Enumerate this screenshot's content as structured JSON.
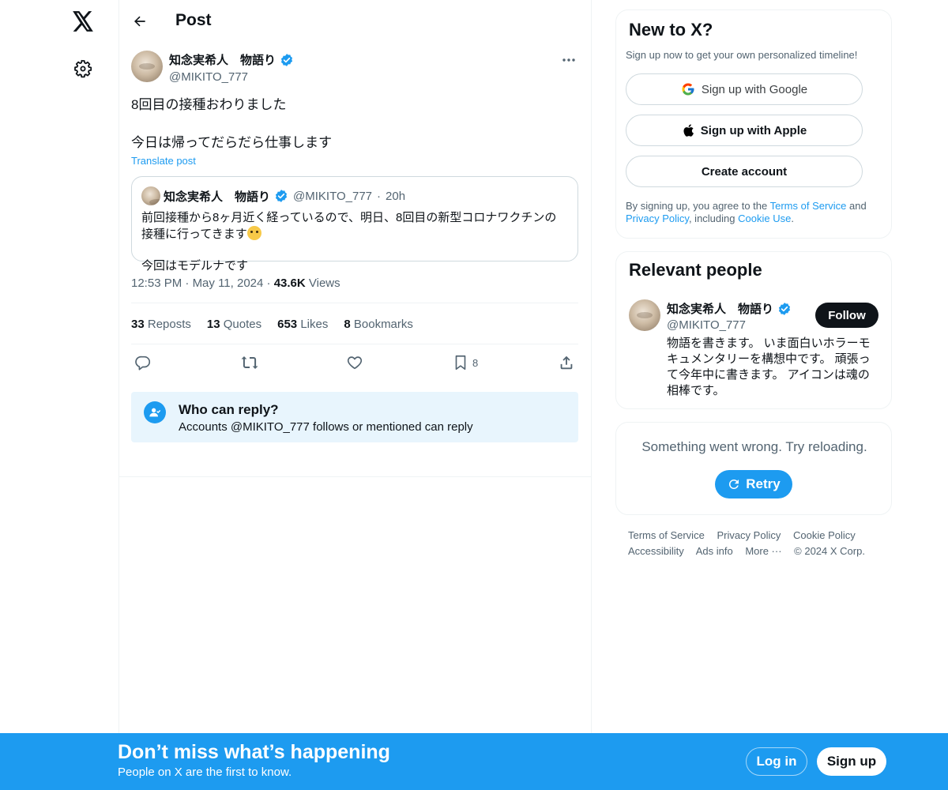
{
  "nav": {
    "logo_icon": "x-logo-icon",
    "settings_icon": "gear-icon"
  },
  "header": {
    "title": "Post"
  },
  "post": {
    "author": {
      "name": "知念実希人　物語り",
      "handle": "@MIKITO_777",
      "verified": true
    },
    "text": "8回目の接種おわりました\n\n今日は帰ってだらだら仕事します",
    "translate_label": "Translate post",
    "quote": {
      "author_name": "知念実希人　物語り",
      "handle": "@MIKITO_777",
      "separator": "·",
      "time": "20h",
      "text_line1": "前回接種から8ヶ月近く経っているので、明日、8回目の新型コロナワクチンの接種に行ってきます",
      "text_line2": "今回はモデルナです"
    },
    "time": "12:53 PM",
    "date": "May 11, 2024",
    "views_count": "43.6K",
    "views_label": "Views",
    "stats": {
      "reposts_count": "33",
      "reposts_label": "Reposts",
      "quotes_count": "13",
      "quotes_label": "Quotes",
      "likes_count": "653",
      "likes_label": "Likes",
      "bookmarks_count": "8",
      "bookmarks_label": "Bookmarks"
    },
    "actions": {
      "bookmark_count": "8"
    },
    "reply_notice": {
      "title": "Who can reply?",
      "subtitle": "Accounts @MIKITO_777 follows or mentioned can reply"
    }
  },
  "sidebar": {
    "new_to_x": {
      "title": "New to X?",
      "subtitle": "Sign up now to get your own personalized timeline!",
      "google_label": "Sign up with Google",
      "apple_label": "Sign up with Apple",
      "create_label": "Create account",
      "legal_prefix": "By signing up, you agree to the ",
      "terms_link": "Terms of Service",
      "legal_and": " and ",
      "privacy_link": "Privacy Policy",
      "legal_including": ", including ",
      "cookie_link": "Cookie Use",
      "legal_end": "."
    },
    "relevant": {
      "title": "Relevant people",
      "name": "知念実希人　物語り",
      "handle": "@MIKITO_777",
      "follow_label": "Follow",
      "bio": "物語を書きます。 いま面白いホラーモキュメンタリーを構想中です。 頑張って今年中に書きます。 アイコンは魂の相棒です。"
    },
    "error": {
      "message": "Something went wrong. Try reloading.",
      "retry_label": "Retry"
    },
    "footer": {
      "terms": "Terms of Service",
      "privacy": "Privacy Policy",
      "cookie": "Cookie Policy",
      "accessibility": "Accessibility",
      "ads": "Ads info",
      "more": "More ···",
      "copyright": "© 2024 X Corp."
    }
  },
  "bottom_bar": {
    "title": "Don’t miss what’s happening",
    "subtitle": "People on X are the first to know.",
    "login_label": "Log in",
    "signup_label": "Sign up"
  },
  "colors": {
    "accent": "#1d9bf0",
    "text": "#0f1419",
    "muted": "#536471",
    "border": "#eff3f4",
    "reply_bg": "#e8f5fd"
  }
}
